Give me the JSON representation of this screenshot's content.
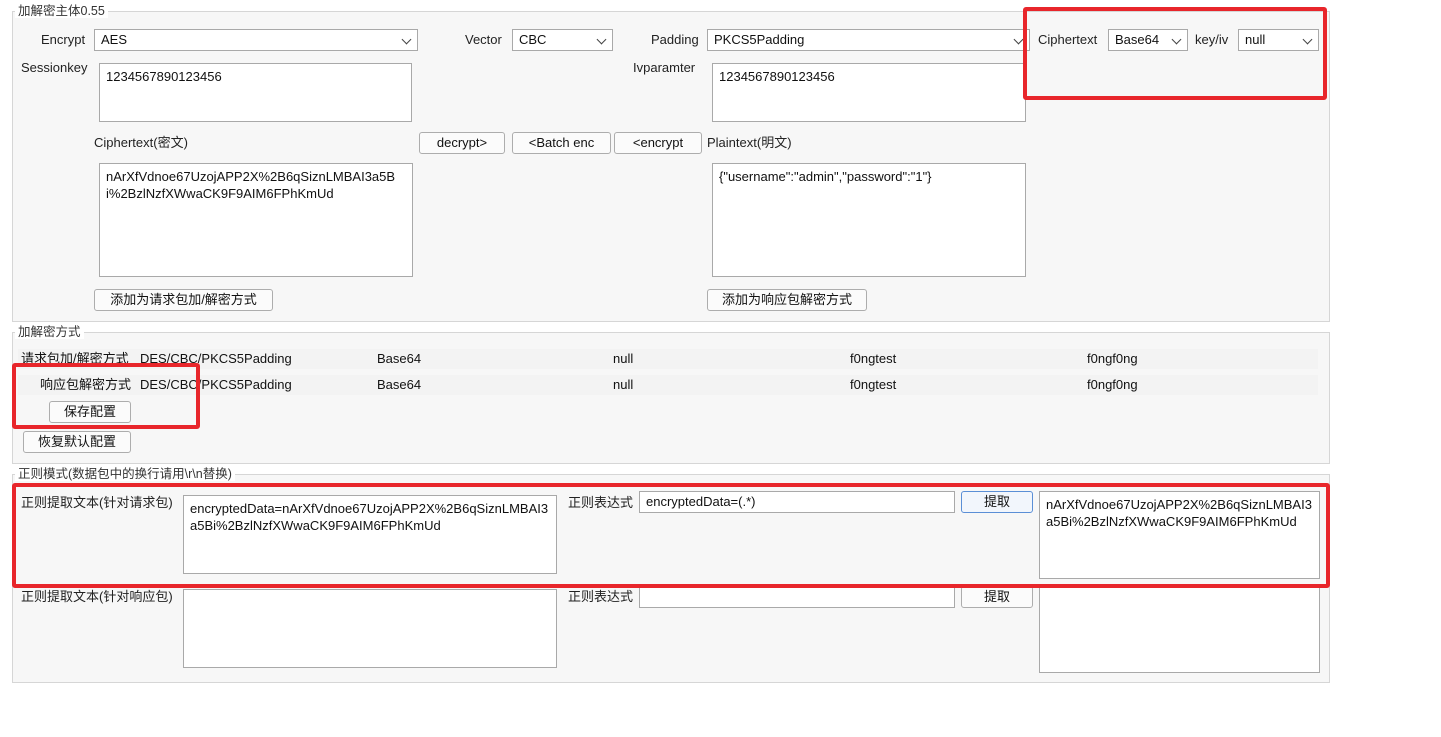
{
  "section1": {
    "title": "加解密主体0.55",
    "encrypt_label": "Encrypt",
    "encrypt_value": "AES",
    "vector_label": "Vector",
    "vector_value": "CBC",
    "padding_label": "Padding",
    "padding_value": "PKCS5Padding",
    "ciphertext_label": "Ciphertext",
    "ciphertext_format": "Base64",
    "keyiv_label": "key/iv",
    "keyiv_value": "null",
    "sessionkey_label": "Sessionkey",
    "sessionkey_value": "1234567890123456",
    "ivparam_label": "Ivparamter",
    "ivparam_value": "1234567890123456",
    "ciphertext_area_label": "Ciphertext(密文)",
    "plaintext_area_label": "Plaintext(明文)",
    "ciphertext_text": "nArXfVdnoe67UzojAPP2X%2B6qSiznLMBAI3a5Bi%2BzlNzfXWwaCK9F9AIM6FPhKmUd",
    "plaintext_text": "{\"username\":\"admin\",\"password\":\"1\"}",
    "decrypt_button": "decrypt>",
    "batch_button": "<Batch enc",
    "encrypt_button": "<encrypt",
    "add_request_button": "添加为请求包加/解密方式",
    "add_response_button": "添加为响应包解密方式"
  },
  "section2": {
    "title": "加解密方式",
    "rows": [
      {
        "label": "请求包加/解密方式",
        "method": "DES/CBC/PKCS5Padding",
        "format": "Base64",
        "keyiv": "null",
        "key": "f0ngtest",
        "iv": "f0ngf0ng"
      },
      {
        "label": "响应包解密方式",
        "method": "DES/CBC/PKCS5Padding",
        "format": "Base64",
        "keyiv": "null",
        "key": "f0ngtest",
        "iv": "f0ngf0ng"
      }
    ],
    "save_button": "保存配置",
    "restore_button": "恢复默认配置"
  },
  "section3": {
    "title": "正则模式(数据包中的换行请用\\r\\n替换)",
    "req_label": "正则提取文本(针对请求包)",
    "req_text": "encryptedData=nArXfVdnoe67UzojAPP2X%2B6qSiznLMBAI3a5Bi%2BzlNzfXWwaCK9F9AIM6FPhKmUd",
    "req_regex_label": "正则表达式",
    "req_regex_value": "encryptedData=(.*)",
    "req_extract_button": "提取",
    "req_result": "nArXfVdnoe67UzojAPP2X%2B6qSiznLMBAI3a5Bi%2BzlNzfXWwaCK9F9AIM6FPhKmUd",
    "resp_label": "正则提取文本(针对响应包)",
    "resp_text": "",
    "resp_regex_label": "正则表达式",
    "resp_regex_value": "",
    "resp_extract_button": "提取",
    "resp_result": ""
  },
  "colors": {
    "highlight": "#e8262b",
    "focus_border": "#5b8fd6"
  }
}
